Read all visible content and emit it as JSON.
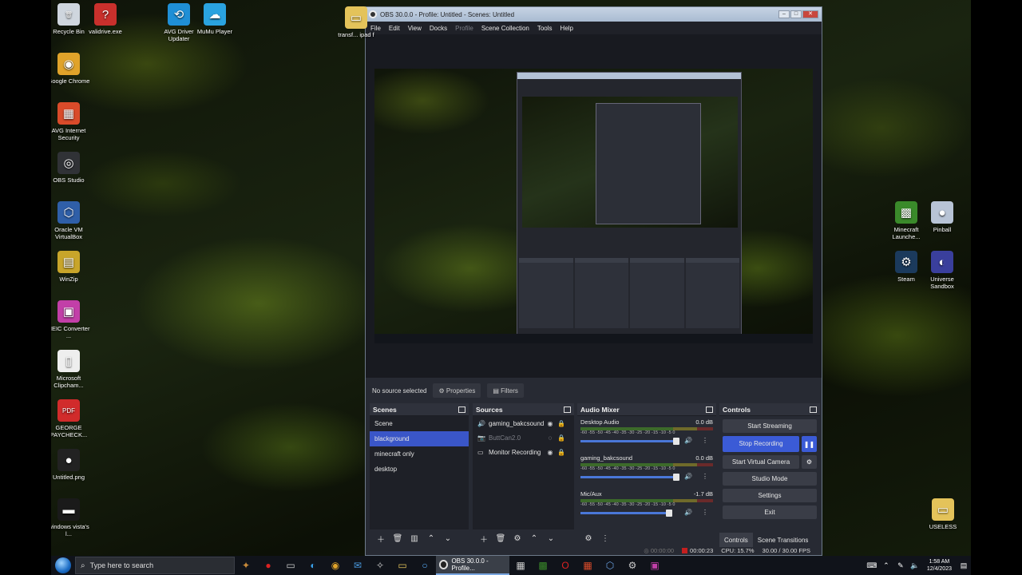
{
  "desktop": {
    "left_icons": [
      {
        "label": "Recycle Bin",
        "icon": "recycle-bin-icon",
        "color": "#cfd6de",
        "glyph": "🗑"
      },
      {
        "label": "validrive.exe",
        "icon": "question-mark-icon",
        "color": "#c9302c",
        "glyph": "?"
      },
      {
        "label": "Google Chrome",
        "icon": "chrome-icon",
        "color": "#e0a32a",
        "glyph": "◉"
      },
      {
        "label": "AVG Internet Security",
        "icon": "avg-icon",
        "color": "#d94b2a",
        "glyph": "▦"
      },
      {
        "label": "OBS Studio",
        "icon": "obs-icon",
        "color": "#303236",
        "glyph": "◎"
      },
      {
        "label": "Oracle VM VirtualBox",
        "icon": "virtualbox-icon",
        "color": "#2f5fa8",
        "glyph": "⬡"
      },
      {
        "label": "WinZip",
        "icon": "winzip-icon",
        "color": "#c8a52a",
        "glyph": "▤"
      },
      {
        "label": "HEIC Converter ...",
        "icon": "heic-icon",
        "color": "#c23fa8",
        "glyph": "▣"
      },
      {
        "label": "Microsoft Clipcham...",
        "icon": "document-icon",
        "color": "#eeeeee",
        "glyph": "▯"
      },
      {
        "label": "GEORGE PAYCHECK...",
        "icon": "pdf-icon",
        "color": "#d12b2b",
        "glyph": "PDF"
      },
      {
        "label": "Untitled.png",
        "icon": "image-icon",
        "color": "#222222",
        "glyph": "●"
      },
      {
        "label": "windows vista's l...",
        "icon": "image-icon",
        "color": "#1a1a1a",
        "glyph": "▬"
      }
    ],
    "top_icons": [
      {
        "label": "AVG Driver Updater",
        "icon": "avg-driver-icon",
        "color": "#1f8fd6",
        "glyph": "⟲"
      },
      {
        "label": "MuMu Player",
        "icon": "mumu-icon",
        "color": "#2aa3e0",
        "glyph": "☁"
      },
      {
        "label": "transf... ipad f",
        "icon": "folder-icon",
        "color": "#e4c35a",
        "glyph": "▭"
      }
    ],
    "right_icons": [
      {
        "label": "Minecraft Launche...",
        "icon": "minecraft-icon",
        "color": "#3a8a2a",
        "glyph": "▩"
      },
      {
        "label": "Pinball",
        "icon": "pinball-icon",
        "color": "#b8c4d6",
        "glyph": "●"
      },
      {
        "label": "Steam",
        "icon": "steam-icon",
        "color": "#1b3a5c",
        "glyph": "⚙"
      },
      {
        "label": "Universe Sandbox",
        "icon": "universe-sandbox-icon",
        "color": "#3a3f9c",
        "glyph": "◐"
      },
      {
        "label": "USELESS",
        "icon": "folder-icon",
        "color": "#e4c35a",
        "glyph": "▭"
      }
    ]
  },
  "obs": {
    "title": "OBS 30.0.0 - Profile: Untitled - Scenes: Untitled",
    "menu": [
      "File",
      "Edit",
      "View",
      "Docks",
      "Profile",
      "Scene Collection",
      "Tools",
      "Help"
    ],
    "source_bar": {
      "status": "No source selected",
      "properties": "Properties",
      "filters": "Filters"
    },
    "scenes": {
      "title": "Scenes",
      "items": [
        {
          "label": "Scene",
          "active": false
        },
        {
          "label": "blackground",
          "active": true
        },
        {
          "label": "minecraft only",
          "active": false
        },
        {
          "label": "desktop",
          "active": false
        }
      ]
    },
    "sources": {
      "title": "Sources",
      "items": [
        {
          "label": "gaming_bakcsound",
          "icon": "speaker-icon",
          "hidden": false
        },
        {
          "label": "ButtCan2.0",
          "icon": "camera-icon",
          "hidden": true
        },
        {
          "label": "Monitor Recording",
          "icon": "monitor-icon",
          "hidden": false
        }
      ]
    },
    "mixer": {
      "title": "Audio Mixer",
      "ticks": "-60 -55 -50 -45 -40 -35 -30 -25 -20 -15 -10 -5 0",
      "channels": [
        {
          "name": "Desktop Audio",
          "db": "0.0 dB",
          "level": 0.97
        },
        {
          "name": "gaming_bakcsound",
          "db": "0.0 dB",
          "level": 0.97
        },
        {
          "name": "Mic/Aux",
          "db": "-1.7 dB",
          "level": 0.9
        }
      ]
    },
    "controls": {
      "title": "Controls",
      "start_streaming": "Start Streaming",
      "stop_recording": "Stop Recording",
      "start_virtual_camera": "Start Virtual Camera",
      "studio_mode": "Studio Mode",
      "settings": "Settings",
      "exit": "Exit",
      "tab_controls": "Controls",
      "tab_transitions": "Scene Transitions"
    },
    "status": {
      "stream_time": "00:00:00",
      "rec_time": "00:00:23",
      "cpu": "CPU: 15.7%",
      "fps": "30.00 / 30.00 FPS"
    }
  },
  "taskbar": {
    "search_placeholder": "Type here to search",
    "active_app": "OBS 30.0.0 - Profile...",
    "time": "1:58 AM",
    "date": "12/4/2023"
  }
}
